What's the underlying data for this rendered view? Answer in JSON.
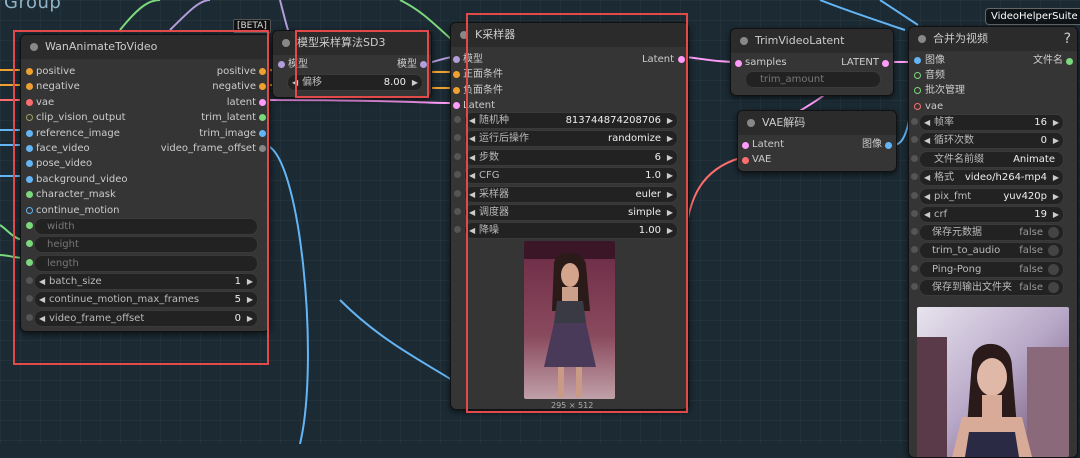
{
  "canvas": {
    "group_title": "Group"
  },
  "badges": {
    "beta": "[BETA]",
    "vhs": "VideoHelperSuite"
  },
  "node_wan": {
    "title": "WanAnimateToVideo",
    "inputs": [
      "positive",
      "negative",
      "vae",
      "clip_vision_output",
      "reference_image",
      "face_video",
      "pose_video",
      "background_video",
      "character_mask",
      "continue_motion"
    ],
    "outputs": [
      "positive",
      "negative",
      "latent",
      "trim_latent",
      "trim_image",
      "video_frame_offset"
    ],
    "disabled_widgets": [
      "width",
      "height",
      "length"
    ],
    "widgets": [
      {
        "label": "batch_size",
        "value": "1"
      },
      {
        "label": "continue_motion_max_frames",
        "value": "5"
      },
      {
        "label": "video_frame_offset",
        "value": "0"
      }
    ]
  },
  "node_sd3": {
    "title": "模型采样算法SD3",
    "input": "模型",
    "output": "模型",
    "widget": {
      "label": "偏移",
      "value": "8.00"
    }
  },
  "node_ksampler": {
    "title": "K采样器",
    "inputs": [
      "模型",
      "正面条件",
      "负面条件",
      "Latent"
    ],
    "output": "Latent",
    "widgets": [
      {
        "label": "随机种",
        "value": "813744874208706"
      },
      {
        "label": "运行后操作",
        "value": "randomize"
      },
      {
        "label": "步数",
        "value": "6"
      },
      {
        "label": "CFG",
        "value": "1.0"
      },
      {
        "label": "采样器",
        "value": "euler"
      },
      {
        "label": "调度器",
        "value": "simple"
      },
      {
        "label": "降噪",
        "value": "1.00"
      }
    ],
    "image_size": "295 × 512"
  },
  "node_trim": {
    "title": "TrimVideoLatent",
    "input": "samples",
    "output": "LATENT",
    "widget": "trim_amount"
  },
  "node_vae": {
    "title": "VAE解码",
    "inputs": [
      "Latent",
      "VAE"
    ],
    "output": "图像"
  },
  "node_video": {
    "title": "合并为视频",
    "help": "?",
    "inputs": [
      "图像",
      "音频",
      "批次管理",
      "vae"
    ],
    "output": "文件名",
    "widgets": [
      {
        "label": "帧率",
        "value": "16",
        "arrows": true
      },
      {
        "label": "循环次数",
        "value": "0",
        "arrows": true
      },
      {
        "label": "文件名前缀",
        "value": "Animate",
        "arrows": false
      },
      {
        "label": "格式",
        "value": "video/h264-mp4",
        "arrows": true
      },
      {
        "label": "pix_fmt",
        "value": "yuv420p",
        "arrows": true
      },
      {
        "label": "crf",
        "value": "19",
        "arrows": true
      }
    ],
    "toggles": [
      {
        "label": "保存元数据",
        "value": "false"
      },
      {
        "label": "trim_to_audio",
        "value": "false"
      },
      {
        "label": "Ping-Pong",
        "value": "false"
      },
      {
        "label": "保存到输出文件夹",
        "value": "false"
      }
    ]
  },
  "colors": {
    "conditioning": "#f0a030",
    "vae": "#ff6e6e",
    "clip_vision": "#a0a060",
    "image": "#64b5f6",
    "latent": "#ff9cf9",
    "model": "#b39ddb",
    "int": "#7cd87c",
    "highlight": "#e24a4a"
  }
}
